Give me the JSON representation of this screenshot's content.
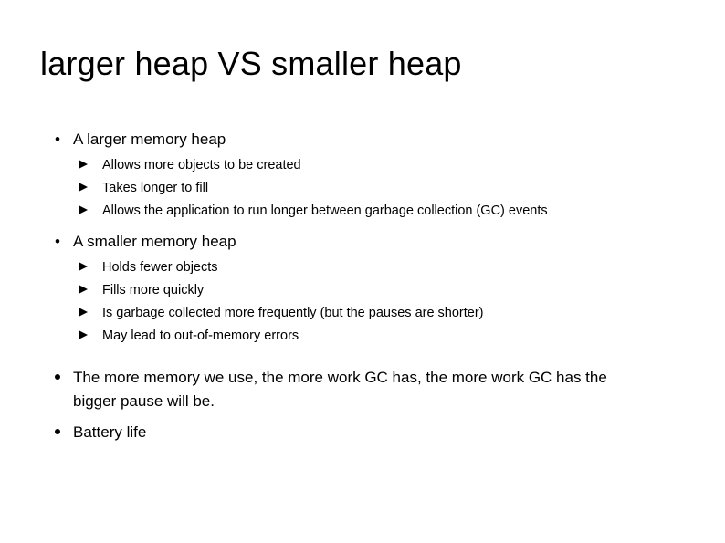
{
  "slide": {
    "title": "larger heap VS smaller heap",
    "background_color": "#ffffff",
    "text_color": "#000000",
    "groups": [
      {
        "bullet_marker": "•",
        "heading": "A larger memory heap",
        "sub_marker": "Ø",
        "sub_items": [
          "Allows more objects to be created",
          "Takes longer to fill",
          "Allows the application to run longer between garbage collection (GC) events"
        ]
      },
      {
        "bullet_marker": "•",
        "heading": "A smaller memory heap",
        "sub_marker": "Ø",
        "sub_items": [
          "Holds fewer objects",
          "Fills more quickly",
          "Is garbage collected more frequently (but the pauses are shorter)",
          "May lead to out-of-memory errors"
        ]
      }
    ],
    "bottom_points": [
      "The more memory we use, the more work GC has, the more work GC has the bigger pause will be.",
      "Battery life"
    ]
  }
}
